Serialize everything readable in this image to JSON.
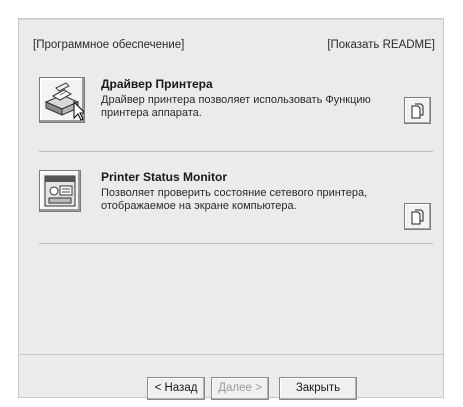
{
  "header": {
    "software_link": "[Программное обеспечение]",
    "readme_link": "[Показать README]"
  },
  "items": [
    {
      "title": "Драйвер Принтера",
      "description": "Драйвер принтера позволяет использовать Функцию принтера аппарата.",
      "icon": "printer-icon"
    },
    {
      "title": "Printer Status Monitor",
      "description": "Позволяет проверить состояние сетевого принтера, отображаемое на экране компьютера.",
      "icon": "status-monitor-icon"
    }
  ],
  "footer": {
    "back_label": "< Назад",
    "next_label": "Далее >",
    "close_label": "Закрыть"
  }
}
